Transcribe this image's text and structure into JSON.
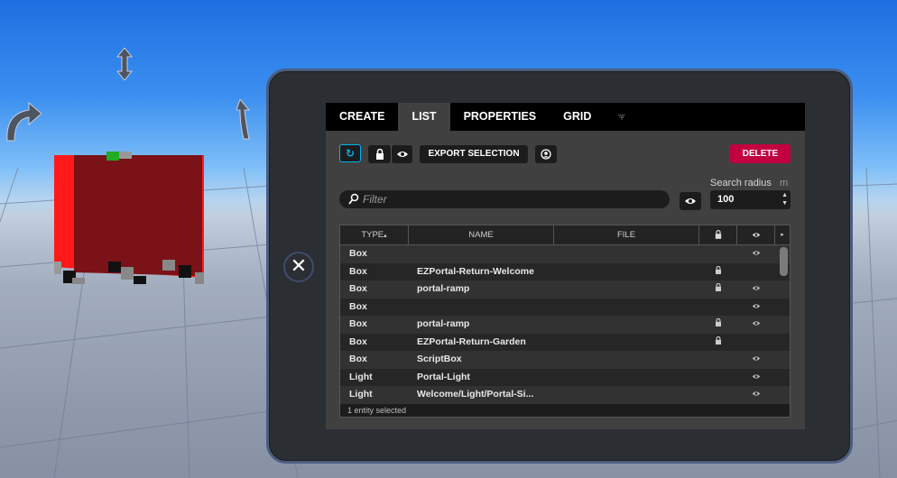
{
  "tabs": [
    {
      "label": "CREATE",
      "active": false
    },
    {
      "label": "LIST",
      "active": true
    },
    {
      "label": "PROPERTIES",
      "active": false
    },
    {
      "label": "GRID",
      "active": false
    }
  ],
  "tab_icon": "particles-icon",
  "toolbar": {
    "refresh_icon": "↻",
    "export_label": "EXPORT SELECTION",
    "delete_label": "DELETE"
  },
  "filter": {
    "placeholder": "Filter"
  },
  "search_radius": {
    "label": "Search radius",
    "unit": "m",
    "value": "100"
  },
  "table": {
    "columns": {
      "type": "TYPE",
      "type_sort": "▴",
      "name": "NAME",
      "file": "FILE"
    },
    "rows": [
      {
        "type": "Box",
        "name": "",
        "locked": false,
        "visible": true
      },
      {
        "type": "Box",
        "name": "EZPortal-Return-Welcome",
        "locked": true,
        "visible": false
      },
      {
        "type": "Box",
        "name": "portal-ramp",
        "locked": true,
        "visible": true
      },
      {
        "type": "Box",
        "name": "",
        "locked": false,
        "visible": true
      },
      {
        "type": "Box",
        "name": "portal-ramp",
        "locked": true,
        "visible": true
      },
      {
        "type": "Box",
        "name": "EZPortal-Return-Garden",
        "locked": true,
        "visible": false
      },
      {
        "type": "Box",
        "name": "ScriptBox",
        "locked": false,
        "visible": true
      },
      {
        "type": "Light",
        "name": "Portal-Light",
        "locked": false,
        "visible": true
      },
      {
        "type": "Light",
        "name": "Welcome/Light/Portal-Si...",
        "locked": false,
        "visible": true
      }
    ],
    "footer": "1 entity selected"
  },
  "colors": {
    "accent": "#00b4ef",
    "delete": "#c2003f",
    "cube": "#7a1218",
    "cube_edge": "#ff1a1a"
  }
}
